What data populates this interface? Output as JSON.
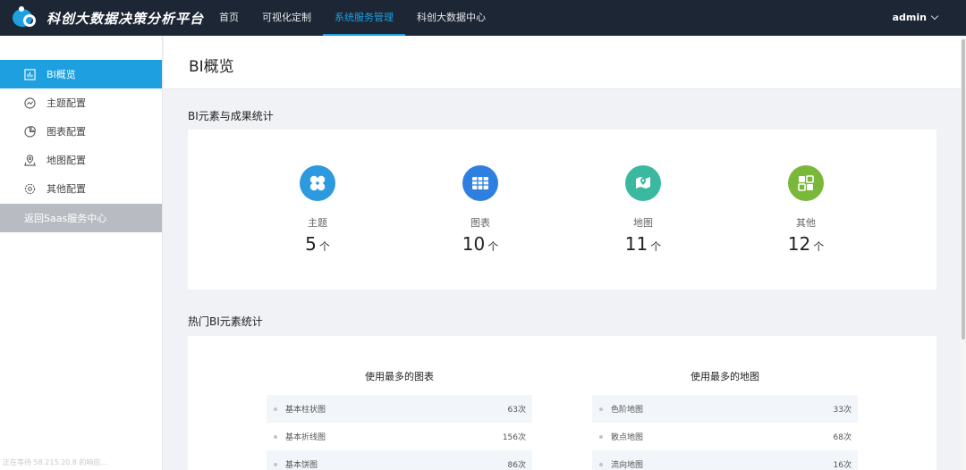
{
  "header": {
    "app_title": "科创大数据决策分析平台",
    "nav": [
      {
        "label": "首页"
      },
      {
        "label": "可视化定制"
      },
      {
        "label": "系统服务管理"
      },
      {
        "label": "科创大数据中心"
      }
    ],
    "active_nav": "系统服务管理",
    "user": "admin"
  },
  "sidebar": {
    "items": [
      {
        "label": "BI概览",
        "icon": "bar-chart-icon"
      },
      {
        "label": "主题配置",
        "icon": "trend-icon"
      },
      {
        "label": "图表配置",
        "icon": "pie-icon"
      },
      {
        "label": "地图配置",
        "icon": "map-pin-icon"
      },
      {
        "label": "其他配置",
        "icon": "gear-icon"
      }
    ],
    "back_label": "返回Saas服务中心",
    "status_text": "正在等待 58.215.20.8 的响应..."
  },
  "page": {
    "title": "BI概览",
    "section1_title": "BI元素与成果统计",
    "section2_title": "热门BI元素统计"
  },
  "stats": [
    {
      "label": "主题",
      "value": "5",
      "unit": "个",
      "color": "#2d9ae0",
      "icon": "theme-icon"
    },
    {
      "label": "图表",
      "value": "10",
      "unit": "个",
      "color": "#2f7fe0",
      "icon": "table-icon"
    },
    {
      "label": "地图",
      "value": "11",
      "unit": "个",
      "color": "#3bb9a0",
      "icon": "map-icon"
    },
    {
      "label": "其他",
      "value": "12",
      "unit": "个",
      "color": "#7ab83a",
      "icon": "grid-icon"
    }
  ],
  "top_charts": {
    "title": "使用最多的图表",
    "rows": [
      {
        "name": "基本柱状图",
        "count": "63次"
      },
      {
        "name": "基本折线图",
        "count": "156次"
      },
      {
        "name": "基本饼图",
        "count": "86次"
      }
    ]
  },
  "top_maps": {
    "title": "使用最多的地图",
    "rows": [
      {
        "name": "色阶地图",
        "count": "33次"
      },
      {
        "name": "散点地图",
        "count": "68次"
      },
      {
        "name": "流向地图",
        "count": "16次"
      }
    ]
  },
  "colors": {
    "topbar": "#1d2634",
    "accent": "#1e9fe0",
    "back_button": "#b8bcc2"
  }
}
